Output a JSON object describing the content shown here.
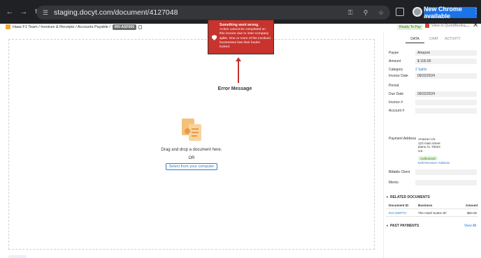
{
  "browser": {
    "url": "staging.docyt.com/document/4127048",
    "update_label": "New Chrome available"
  },
  "header": {
    "breadcrumb_path": "Haas F1 Team / Invoices & Receipts / Accounts Payable /",
    "invoice_badge": "INV-ASF005",
    "status_badge": "Ready To Pay",
    "quickbooks_label": "View in QuickBooks"
  },
  "dropzone": {
    "drop_text": "Drag and drop a document here.",
    "or_text": "OR",
    "select_label": "Select from your computer"
  },
  "error": {
    "title": "Something went wrong.",
    "body": "Action cannot be completed on this invoice due to inter-company splits. One or more of the involved businesses has their books locked.",
    "annotation": "Error Message"
  },
  "panel": {
    "tabs": [
      "DATA",
      "CHAT",
      "ACTIVITY"
    ],
    "fields": {
      "payee_label": "Payee",
      "payee_value": "Amazon",
      "amount_label": "Amount",
      "amount_value": "$ 100.00",
      "category_label": "Category",
      "category_value": "2 Splits",
      "invoice_date_label": "Invoice Date",
      "invoice_date_value": "09/22/2024",
      "period_label": "Period",
      "due_date_label": "Due Date",
      "due_date_value": "09/22/2024",
      "invoice_num_label": "Invoice #",
      "account_num_label": "Account #",
      "payment_address_label": "Payment Address",
      "address_line1": "Amazon US",
      "address_line2": "123 main street",
      "address_line3": "plano AL 75024",
      "address_line4": "US",
      "authorized": "Authorized",
      "edit_address": "Edit Receiver Address",
      "billable_client_label": "Billable Client",
      "memo_label": "Memo"
    },
    "related": {
      "title": "RELATED DOCUMENTS",
      "col_doc": "Document ID",
      "col_business": "Business",
      "col_amount": "Amount",
      "row_doc": "INV-208FT5",
      "row_business": "The Hotel Suites SF",
      "row_amount": "$50.00"
    },
    "past": {
      "title": "PAST PAYMENTS",
      "view_all": "View All"
    }
  }
}
